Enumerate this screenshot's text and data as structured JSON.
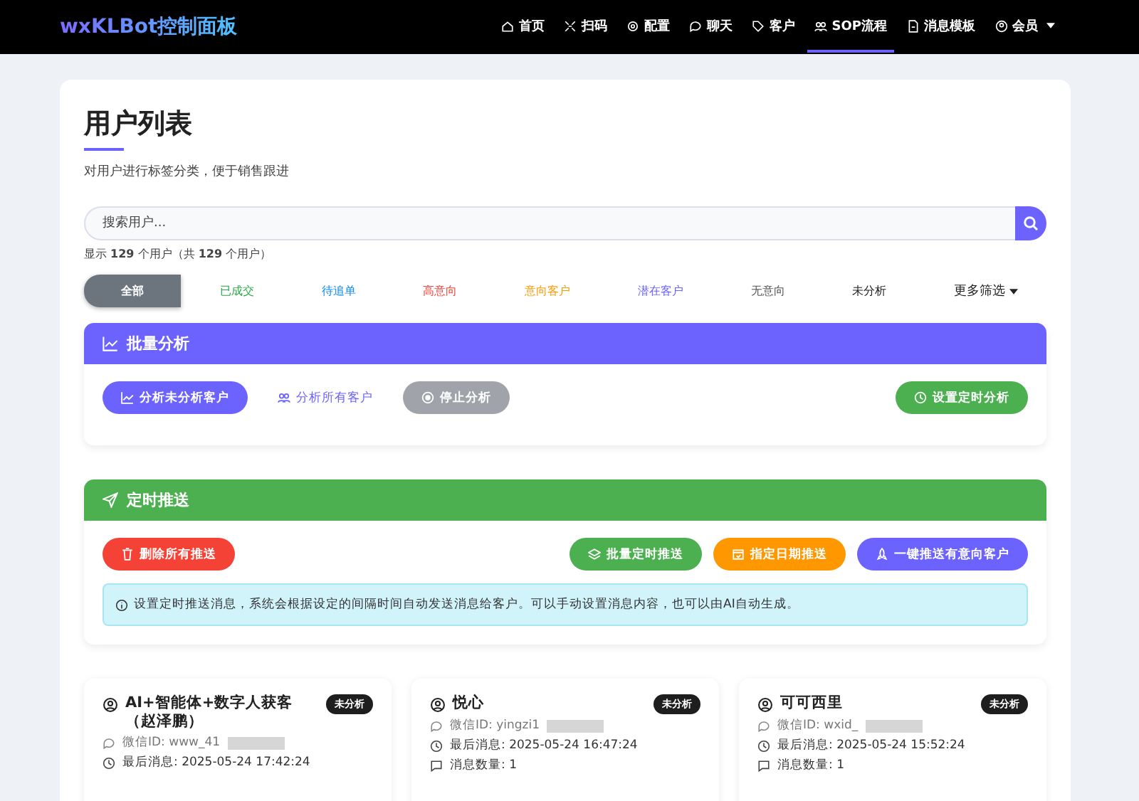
{
  "navbar": {
    "brand": "wxKLBot控制面板",
    "items": [
      {
        "label": "首页",
        "selected": false,
        "dropdown": false
      },
      {
        "label": "扫码",
        "selected": false,
        "dropdown": false
      },
      {
        "label": "配置",
        "selected": false,
        "dropdown": false
      },
      {
        "label": "聊天",
        "selected": false,
        "dropdown": false
      },
      {
        "label": "客户",
        "selected": false,
        "dropdown": false
      },
      {
        "label": "SOP流程",
        "selected": true,
        "dropdown": false
      },
      {
        "label": "消息模板",
        "selected": false,
        "dropdown": false
      },
      {
        "label": "会员",
        "selected": false,
        "dropdown": true
      }
    ]
  },
  "page": {
    "title": "用户列表",
    "subtitle": "对用户进行标签分类，便于销售跟进",
    "search": {
      "placeholder": "搜索用户..."
    },
    "count_text": "显示 **129** 个用户（共 **129** 个用户）",
    "filters": [
      {
        "label": "全部",
        "selected": true,
        "color": "#6c757d",
        "kind": "tab"
      },
      {
        "label": "已成交",
        "selected": false,
        "color": "#28a745",
        "kind": "tab"
      },
      {
        "label": "待追单",
        "selected": false,
        "color": "#0d8bf2",
        "kind": "tab"
      },
      {
        "label": "高意向",
        "selected": false,
        "color": "#f44336",
        "kind": "tab"
      },
      {
        "label": "意向客户",
        "selected": false,
        "color": "#ff9800",
        "kind": "tab"
      },
      {
        "label": "潜在客户",
        "selected": false,
        "color": "#6c63ff",
        "kind": "tab"
      },
      {
        "label": "无意向",
        "selected": false,
        "color": "#555555",
        "kind": "tab"
      },
      {
        "label": "未分析",
        "selected": false,
        "color": "#222222",
        "kind": "tab"
      },
      {
        "label": "更多筛选",
        "selected": false,
        "color": "#222222",
        "kind": "dropdown"
      }
    ]
  },
  "batch_analysis": {
    "title": "批量分析",
    "buttons": [
      {
        "label": "分析未分析客户",
        "disabled": false
      },
      {
        "label": "分析所有客户",
        "disabled": false
      },
      {
        "label": "停止分析",
        "disabled": true
      },
      {
        "label": "设置定时分析",
        "disabled": false
      }
    ]
  },
  "scheduled_push": {
    "title": "定时推送",
    "buttons": [
      {
        "label": "删除所有推送"
      },
      {
        "label": "批量定时推送"
      },
      {
        "label": "指定日期推送"
      },
      {
        "label": "一键推送有意向客户"
      }
    ],
    "info": "设置定时推送消息，系统会根据设定的间隔时间自动发送消息给客户。可以手动设置消息内容，也可以由AI自动生成。"
  },
  "users": [
    {
      "name": "AI+智能体+数字人获客（赵泽鹏）",
      "badge": "未分析",
      "wechat_id": "微信ID: www_41",
      "last_message": "最后消息: 2025-05-24 17:42:24"
    },
    {
      "name": "悦心",
      "badge": "未分析",
      "wechat_id": "微信ID: yingzi1",
      "last_message": "最后消息: 2025-05-24 16:47:24",
      "message_count": "消息数量: 1"
    },
    {
      "name": "可可西里",
      "badge": "未分析",
      "wechat_id": "微信ID: wxid_",
      "last_message": "最后消息: 2025-05-24 15:52:24",
      "message_count": "消息数量: 1"
    }
  ]
}
